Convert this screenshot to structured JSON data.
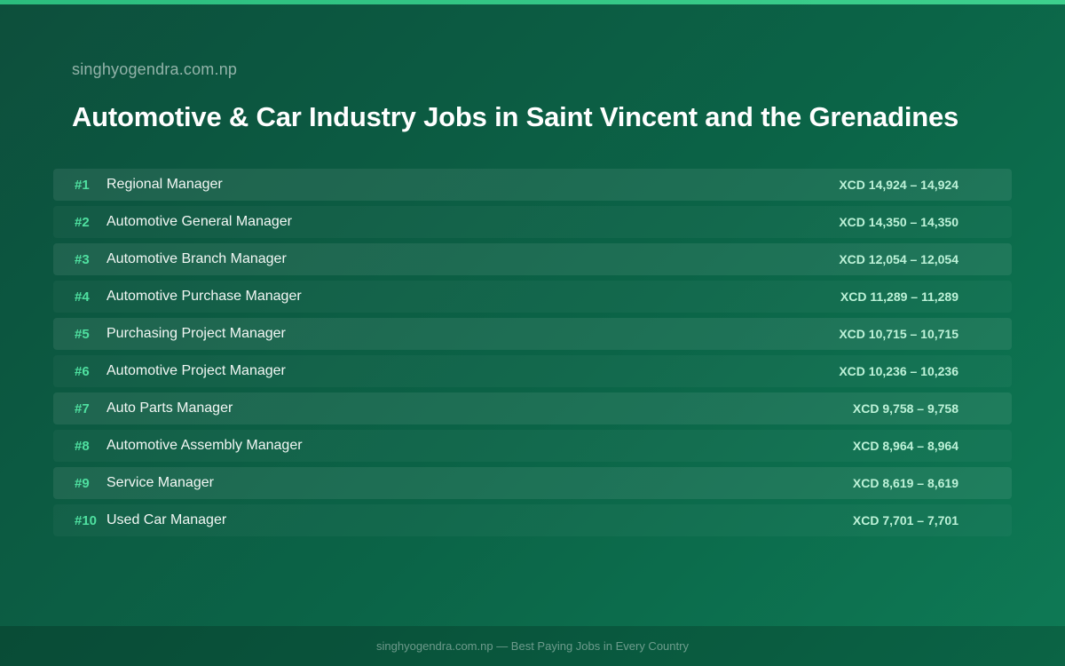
{
  "header": {
    "site": "singhyogendra.com.np",
    "title": "Automotive & Car Industry Jobs in Saint Vincent and the Grenadines"
  },
  "jobs": [
    {
      "rank": "#1",
      "title": "Regional Manager",
      "salary": "XCD 14,924 – 14,924"
    },
    {
      "rank": "#2",
      "title": "Automotive General Manager",
      "salary": "XCD 14,350 – 14,350"
    },
    {
      "rank": "#3",
      "title": "Automotive Branch Manager",
      "salary": "XCD 12,054 – 12,054"
    },
    {
      "rank": "#4",
      "title": "Automotive Purchase Manager",
      "salary": "XCD 11,289 – 11,289"
    },
    {
      "rank": "#5",
      "title": "Purchasing Project Manager",
      "salary": "XCD 10,715 – 10,715"
    },
    {
      "rank": "#6",
      "title": "Automotive Project Manager",
      "salary": "XCD 10,236 – 10,236"
    },
    {
      "rank": "#7",
      "title": "Auto Parts Manager",
      "salary": "XCD 9,758 – 9,758"
    },
    {
      "rank": "#8",
      "title": "Automotive Assembly Manager",
      "salary": "XCD 8,964 – 8,964"
    },
    {
      "rank": "#9",
      "title": "Service Manager",
      "salary": "XCD 8,619 – 8,619"
    },
    {
      "rank": "#10",
      "title": "Used Car Manager",
      "salary": "XCD 7,701 – 7,701"
    }
  ],
  "footer": {
    "text": "singhyogendra.com.np — Best Paying Jobs in Every Country"
  },
  "colors": {
    "background": "#0b6447",
    "accent": "#3dd08d",
    "rank": "#4fe0a0",
    "salary": "#bdf2d8"
  }
}
